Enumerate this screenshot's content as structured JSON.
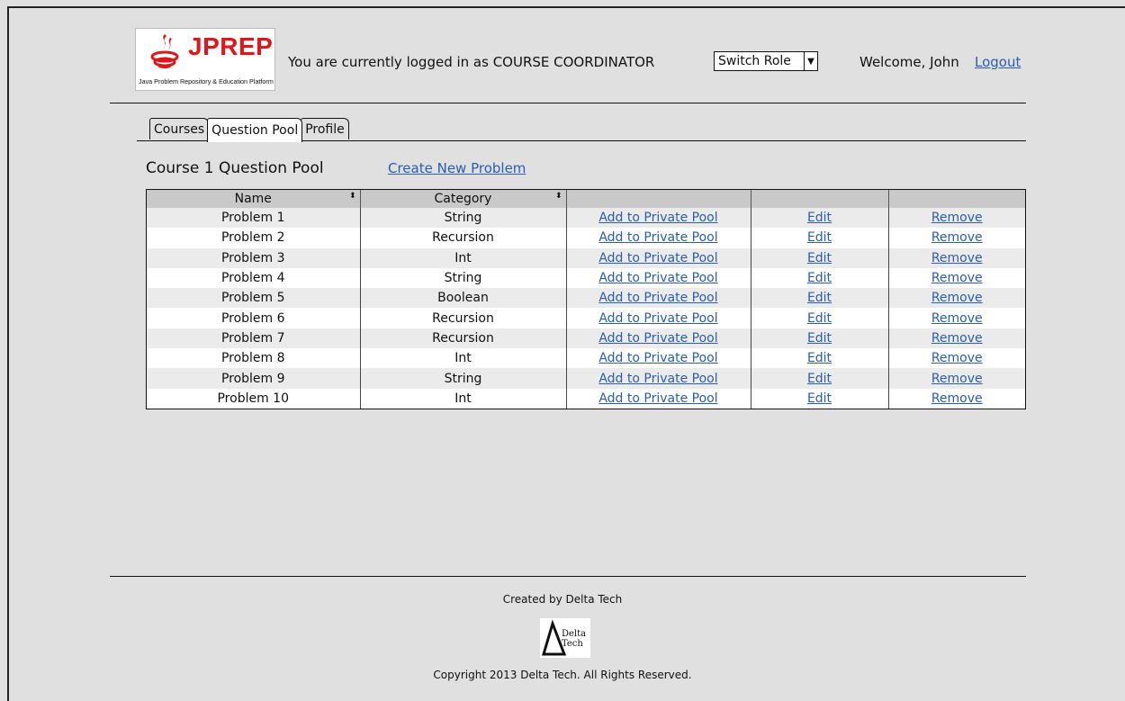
{
  "header": {
    "logo_text": "JPREP",
    "logo_tagline": "Java Problem Repository & Education Platform",
    "status": "You are currently logged in as COURSE COORDINATOR",
    "role_select": "Switch Role",
    "welcome": "Welcome, John",
    "logout": "Logout"
  },
  "tabs": [
    {
      "label": "Courses",
      "active": false
    },
    {
      "label": "Question Pool",
      "active": true
    },
    {
      "label": "Profile",
      "active": false
    }
  ],
  "section": {
    "title": "Course 1 Question Pool",
    "create_link": "Create New Problem"
  },
  "table": {
    "columns": [
      "Name",
      "Category",
      "",
      "",
      ""
    ],
    "rows": [
      {
        "name": "Problem 1",
        "category": "String",
        "add": "Add to Private Pool",
        "edit": "Edit",
        "remove": "Remove"
      },
      {
        "name": "Problem 2",
        "category": "Recursion",
        "add": "Add to Private Pool",
        "edit": "Edit",
        "remove": "Remove"
      },
      {
        "name": "Problem 3",
        "category": "Int",
        "add": "Add to Private Pool",
        "edit": "Edit",
        "remove": "Remove"
      },
      {
        "name": "Problem 4",
        "category": "String",
        "add": "Add to Private Pool",
        "edit": "Edit",
        "remove": "Remove"
      },
      {
        "name": "Problem 5",
        "category": "Boolean",
        "add": "Add to Private Pool",
        "edit": "Edit",
        "remove": "Remove"
      },
      {
        "name": "Problem 6",
        "category": "Recursion",
        "add": "Add to Private Pool",
        "edit": "Edit",
        "remove": "Remove"
      },
      {
        "name": "Problem 7",
        "category": "Recursion",
        "add": "Add to Private Pool",
        "edit": "Edit",
        "remove": "Remove"
      },
      {
        "name": "Problem 8",
        "category": "Int",
        "add": "Add to Private Pool",
        "edit": "Edit",
        "remove": "Remove"
      },
      {
        "name": "Problem 9",
        "category": "String",
        "add": "Add to Private Pool",
        "edit": "Edit",
        "remove": "Remove"
      },
      {
        "name": "Problem 10",
        "category": "Int",
        "add": "Add to Private Pool",
        "edit": "Edit",
        "remove": "Remove"
      }
    ]
  },
  "footer": {
    "created_by": "Created by Delta Tech",
    "logo_line1": "Delta",
    "logo_line2": "Tech",
    "copyright": "Copyright 2013 Delta Tech. All Rights Reserved."
  },
  "colors": {
    "background": "#e0e0e0",
    "brand": "#e0161b",
    "link": "#2a5db0",
    "header_row": "#c9c9c9"
  }
}
